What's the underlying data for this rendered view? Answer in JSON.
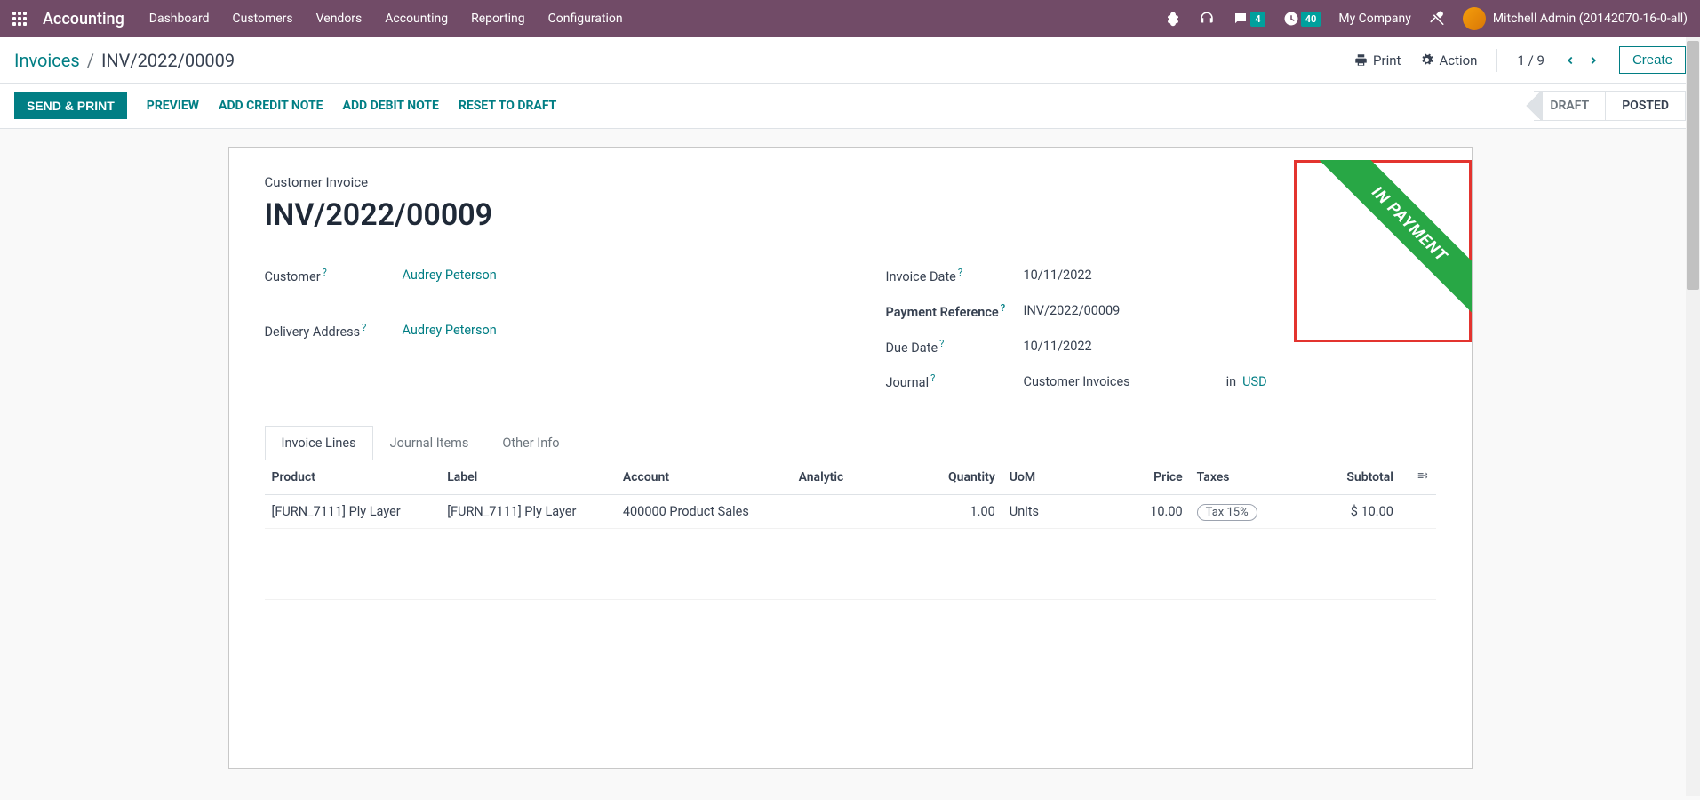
{
  "app": {
    "name": "Accounting"
  },
  "nav": {
    "items": [
      "Dashboard",
      "Customers",
      "Vendors",
      "Accounting",
      "Reporting",
      "Configuration"
    ]
  },
  "topbar": {
    "messages_badge": "4",
    "activities_badge": "40",
    "company": "My Company",
    "user": "Mitchell Admin (20142070-16-0-all)"
  },
  "breadcrumb": {
    "root": "Invoices",
    "current": "INV/2022/00009"
  },
  "cp": {
    "print": "Print",
    "action": "Action",
    "pager": "1 / 9",
    "create": "Create"
  },
  "buttons": {
    "send_print": "SEND & PRINT",
    "preview": "PREVIEW",
    "credit": "ADD CREDIT NOTE",
    "debit": "ADD DEBIT NOTE",
    "reset": "RESET TO DRAFT"
  },
  "status": {
    "draft": "DRAFT",
    "posted": "POSTED"
  },
  "ribbon": "IN PAYMENT",
  "form": {
    "title": "Customer Invoice",
    "name": "INV/2022/00009",
    "labels": {
      "customer": "Customer",
      "delivery": "Delivery Address",
      "invoice_date": "Invoice Date",
      "payment_ref": "Payment Reference",
      "due_date": "Due Date",
      "journal": "Journal"
    },
    "values": {
      "customer": "Audrey Peterson",
      "delivery": "Audrey Peterson",
      "invoice_date": "10/11/2022",
      "payment_ref": "INV/2022/00009",
      "due_date": "10/11/2022",
      "journal": "Customer Invoices",
      "journal_in": "in",
      "currency": "USD"
    }
  },
  "tabs": [
    "Invoice Lines",
    "Journal Items",
    "Other Info"
  ],
  "table": {
    "headers": {
      "product": "Product",
      "label": "Label",
      "account": "Account",
      "analytic": "Analytic",
      "quantity": "Quantity",
      "uom": "UoM",
      "price": "Price",
      "taxes": "Taxes",
      "subtotal": "Subtotal"
    },
    "rows": [
      {
        "product": "[FURN_7111] Ply Layer",
        "label": "[FURN_7111] Ply Layer",
        "account": "400000 Product Sales",
        "analytic": "",
        "quantity": "1.00",
        "uom": "Units",
        "price": "10.00",
        "taxes": "Tax 15%",
        "subtotal": "$ 10.00"
      }
    ]
  }
}
